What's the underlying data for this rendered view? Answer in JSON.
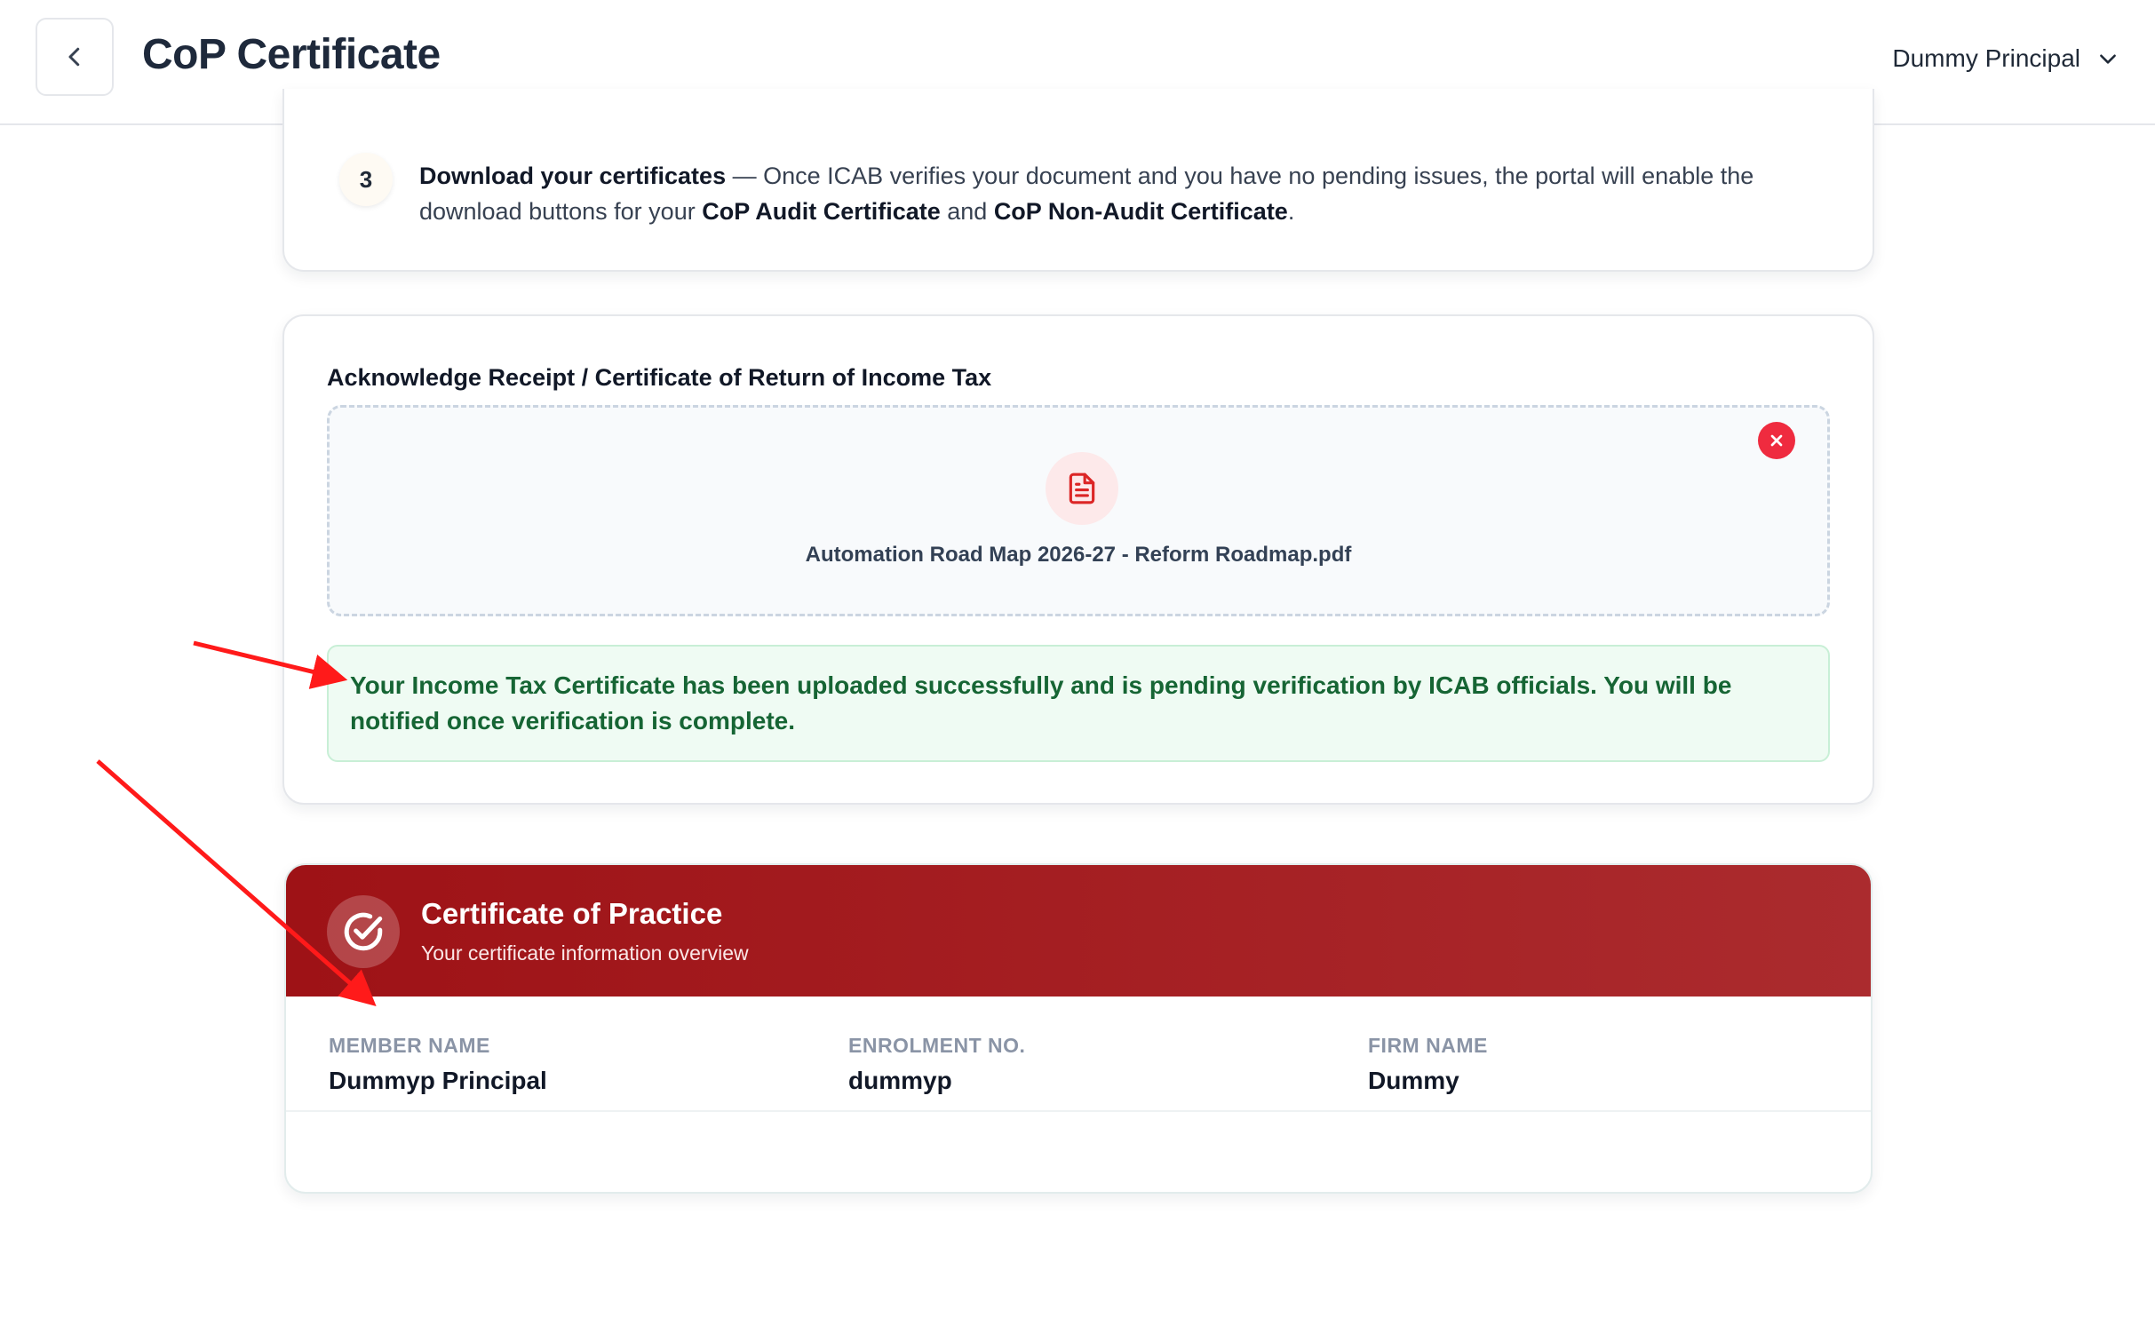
{
  "header": {
    "title": "CoP Certificate",
    "user_name": "Dummy Principal"
  },
  "steps": {
    "number": "3",
    "title": "Download your certificates",
    "text_1": " — Once ICAB verifies your document and you have no pending issues, the portal will enable the download buttons for your ",
    "audit_cert": "CoP Audit Certificate",
    "text_2": " and ",
    "non_audit_cert": "CoP Non-Audit Certificate",
    "text_3": "."
  },
  "upload": {
    "label": "Acknowledge Receipt / Certificate of Return of Income Tax",
    "file_name": "Automation Road Map 2026-27 - Reform Roadmap.pdf",
    "success_message": "Your Income Tax Certificate has been uploaded successfully and is pending verification by ICAB officials. You will be notified once verification is complete."
  },
  "certificate": {
    "title": "Certificate of Practice",
    "subtitle": "Your certificate information overview",
    "fields": [
      {
        "label": "MEMBER NAME",
        "value": "Dummyp Principal"
      },
      {
        "label": "ENROLMENT NO.",
        "value": "dummyp"
      },
      {
        "label": "FIRM NAME",
        "value": "Dummy"
      }
    ]
  },
  "colors": {
    "brand_red": "#9e1216",
    "success_text": "#166534",
    "success_bg": "#effbf3",
    "danger": "#ef2b3f",
    "annotation_arrow": "#ff1a1a"
  },
  "icons": {
    "back": "chevron-left-icon",
    "user_menu": "chevron-down-icon",
    "remove": "close-icon",
    "file": "file-document-icon",
    "certificate": "check-circle-icon"
  }
}
